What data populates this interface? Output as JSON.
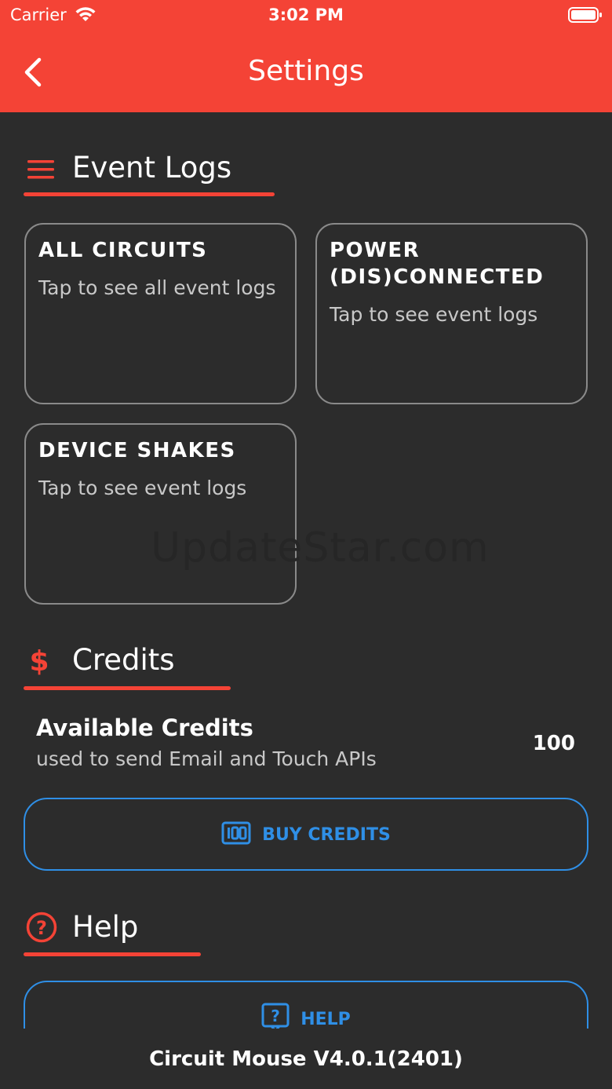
{
  "status_bar": {
    "carrier": "Carrier",
    "time": "3:02 PM",
    "wifi_icon": "wifi-icon",
    "battery_icon": "battery-icon"
  },
  "header": {
    "title": "Settings",
    "back_icon": "chevron-left-icon",
    "background": "#f44336"
  },
  "event_logs": {
    "heading": "Event Logs",
    "icon": "menu-icon",
    "cards": [
      {
        "title": "ALL CIRCUITS",
        "subtitle": "Tap to see all event logs"
      },
      {
        "title": "POWER (DIS)CONNECTED",
        "subtitle": "Tap to see event logs"
      },
      {
        "title": "DEVICE SHAKES",
        "subtitle": "Tap to see event logs"
      }
    ]
  },
  "watermark": "UpdateStar.com",
  "credits": {
    "heading": "Credits",
    "icon": "dollar-icon",
    "available_label": "Available Credits",
    "available_desc": "used to send Email and Touch APIs",
    "available_value": "100",
    "buy_button": "BUY CREDITS",
    "buy_icon": "counter-icon"
  },
  "help": {
    "heading": "Help",
    "icon": "question-circle-icon",
    "button": "HELP",
    "button_icon": "help-box-icon"
  },
  "footer": {
    "version": "Circuit Mouse V4.0.1(2401)"
  },
  "colors": {
    "accent": "#f44336",
    "background": "#2c2c2c",
    "link_blue": "#2f8fe6"
  }
}
